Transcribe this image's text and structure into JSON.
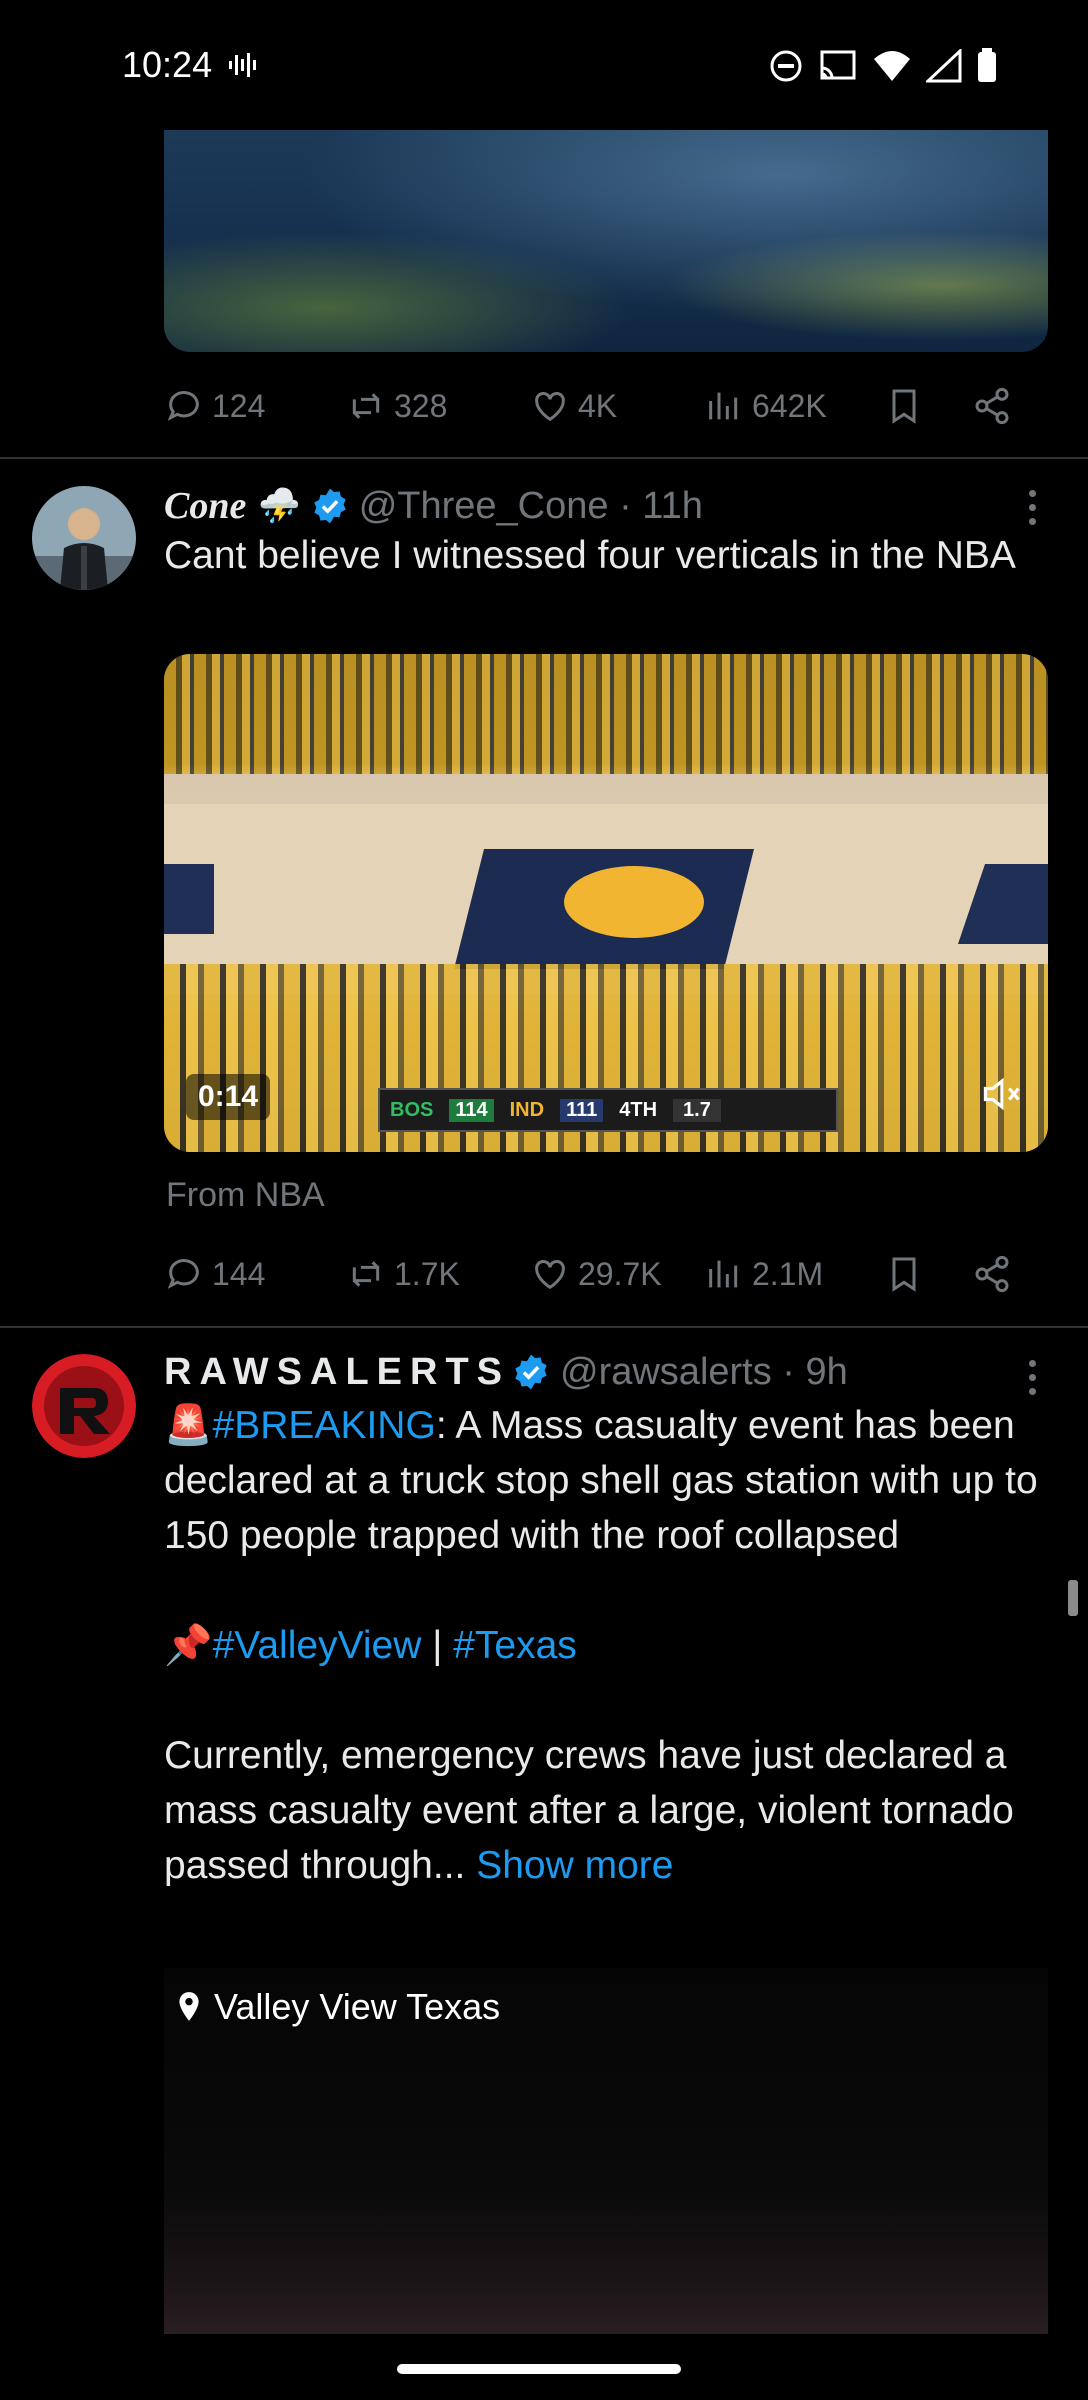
{
  "status_bar": {
    "time": "10:24"
  },
  "tweet_prev": {
    "actions": {
      "replies": "124",
      "retweets": "328",
      "likes": "4K",
      "views": "642K"
    }
  },
  "tweet1": {
    "name": "Cone",
    "emoji": "⛈️",
    "handle": "@Three_Cone · 11h",
    "text": "Cant believe I witnessed four verticals in the NBA",
    "video": {
      "time": "0:14",
      "score_team1": "BOS",
      "score1": "114",
      "score_team2": "IND",
      "score2": "111",
      "quarter": "4TH",
      "clock": "1.7"
    },
    "source": "From NBA",
    "actions": {
      "replies": "144",
      "retweets": "1.7K",
      "likes": "29.7K",
      "views": "2.1M"
    }
  },
  "tweet2": {
    "name": "RAWSALERTS",
    "handle": "@rawsalerts · 9h",
    "alert_emoji": "🚨",
    "hashtag_breaking": "#BREAKING",
    "text_part1": ": A Mass casualty event has been declared at a truck stop shell gas station with up to 150 people trapped with the roof collapsed",
    "pin_emoji": "📌",
    "hashtag_valley": "#ValleyView",
    "separator": " | ",
    "hashtag_texas": "#Texas",
    "text_part2": "Currently, emergency crews have just declared a mass casualty event after a large, violent tornado passed through...",
    "show_more": "Show more",
    "location": "Valley View Texas"
  },
  "colors": {
    "background": "#000000",
    "text": "#e7e9ea",
    "muted": "#71767b",
    "accent": "#1d9bf0",
    "divider": "#2f3336"
  }
}
